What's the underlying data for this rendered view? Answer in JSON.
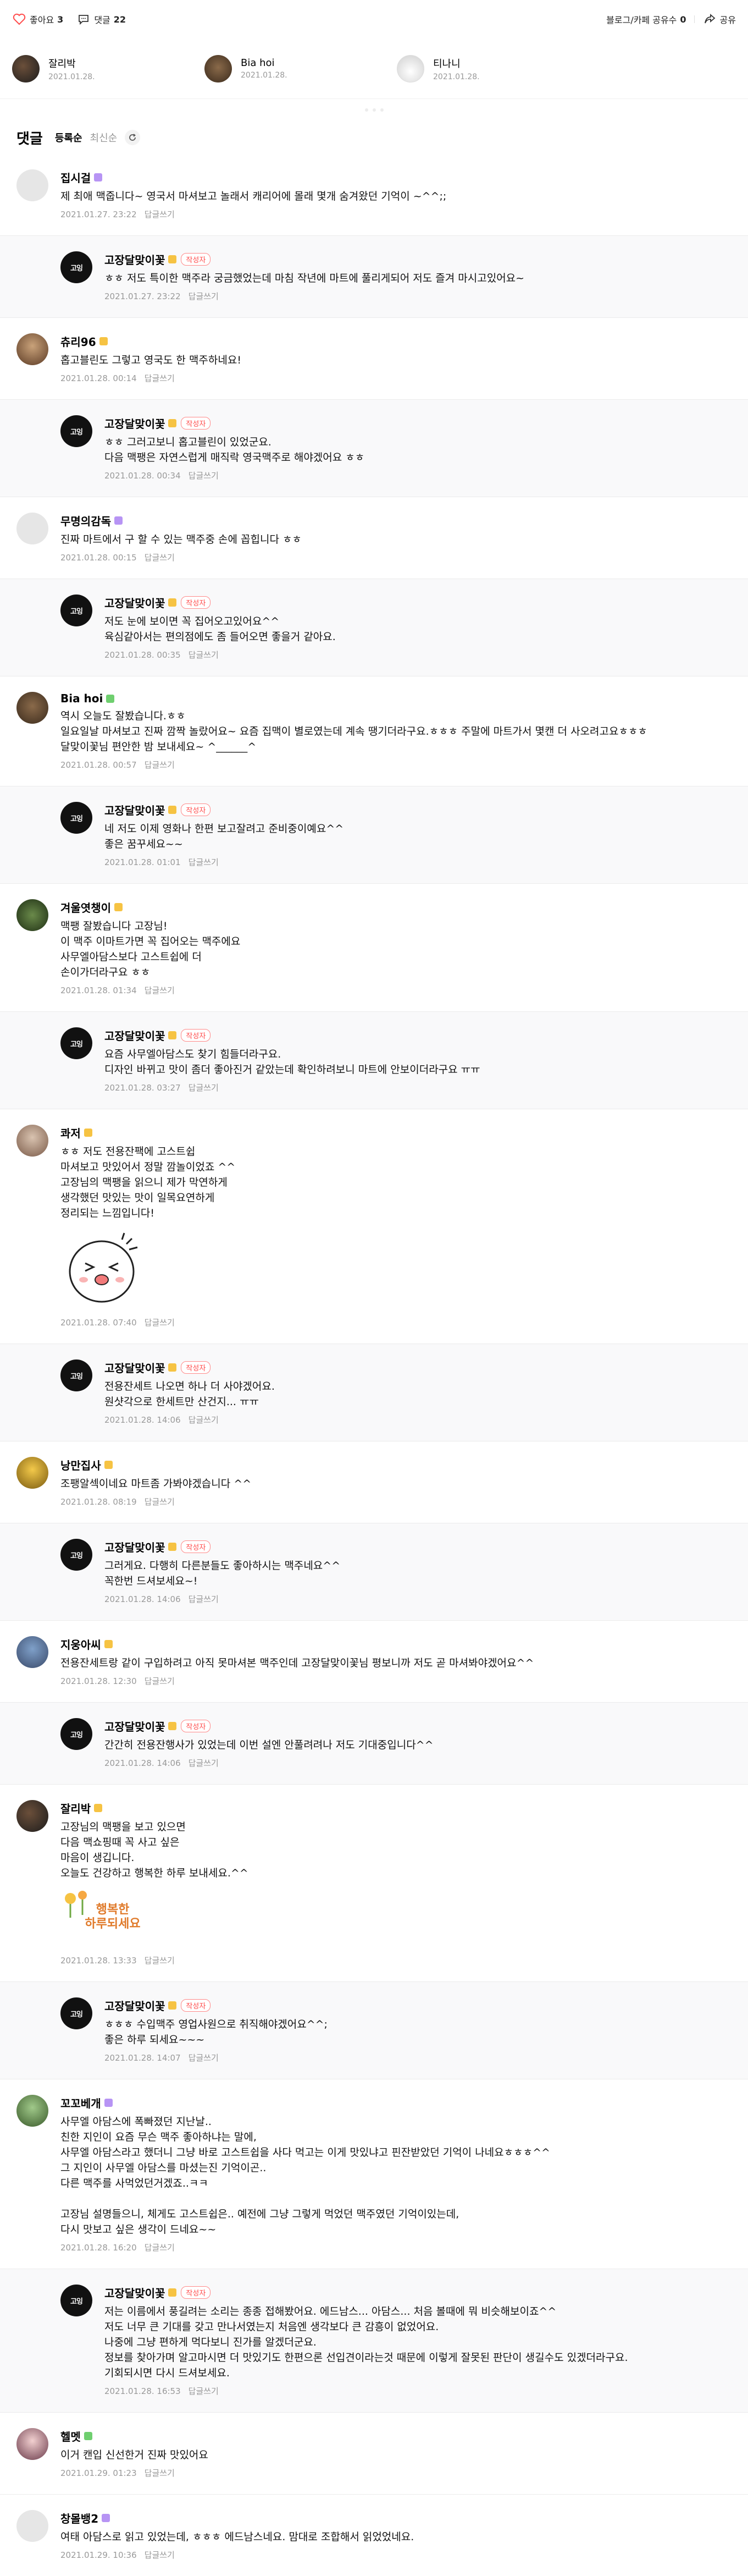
{
  "topbar": {
    "like_label": "좋아요",
    "like_count": "3",
    "comment_label": "댓글",
    "comment_count": "22",
    "share_count_label": "블로그/카페 공유수",
    "share_count": "0",
    "share_label": "공유"
  },
  "likers": [
    {
      "name": "잘리박",
      "date": "2021.01.28."
    },
    {
      "name": "Bia hoi",
      "date": "2021.01.28."
    },
    {
      "name": "티나니",
      "date": "2021.01.28."
    }
  ],
  "comments_header": {
    "title": "댓글",
    "sort_active": "등록순",
    "sort_other": "최신순"
  },
  "writer_badge": "작성자",
  "reply_label": "답글쓰기",
  "avatar_logo_text": "고잉",
  "sticker_text": "행복한\n하루되세요",
  "comments": [
    {
      "name": "집시걸",
      "text": "제 최애 맥줍니다~ 영국서 마셔보고 놀래서 캐리어에 몰래 몇개 숨겨왔던 기억이 ~^^;;",
      "date": "2021.01.27. 23:22"
    },
    {
      "name": "고장달맞이꽃",
      "text": "ㅎㅎ 저도 특이한 맥주라 궁금했었는데 마침 작년에 마트에 풀리게되어 저도 즐겨 마시고있어요~",
      "date": "2021.01.27. 23:22"
    },
    {
      "name": "츄리96",
      "text": "홉고블린도 그렇고 영국도 한 맥주하네요!",
      "date": "2021.01.28. 00:14"
    },
    {
      "name": "고장달맞이꽃",
      "text": "ㅎㅎ 그러고보니 홉고블린이 있었군요.\n다음 맥팽은 자연스럽게 매직락 영국맥주로 해야겠어요 ㅎㅎ",
      "date": "2021.01.28. 00:34"
    },
    {
      "name": "무명의감독",
      "text": "진짜 마트에서 구 할 수 있는 맥주중 손에 꼽힙니다 ㅎㅎ",
      "date": "2021.01.28. 00:15"
    },
    {
      "name": "고장달맞이꽃",
      "text": "저도 눈에 보이면 꼭 집어오고있어요^^\n육심같아서는 편의점에도 좀 들어오면 좋을거 같아요.",
      "date": "2021.01.28. 00:35"
    },
    {
      "name": "Bia hoi",
      "text": "역시 오늘도 잘봤습니다.ㅎㅎ\n일요일날 마셔보고 진짜 깜짝 놀랐어요~ 요즘 집맥이 별로였는데 계속 땡기더라구요.ㅎㅎㅎ 주말에 마트가서 몇캔 더 사오려고요ㅎㅎㅎ\n달맞이꽃님 편안한 밤 보내세요~ ^______^",
      "date": "2021.01.28. 00:57"
    },
    {
      "name": "고장달맞이꽃",
      "text": "네 저도 이제 영화나 한편 보고잘려고 준비중이예요^^\n좋은 꿈꾸세요~~",
      "date": "2021.01.28. 01:01"
    },
    {
      "name": "겨울엿챙이",
      "text": "맥팽 잘봤습니다 고장님!\n이 맥주 이마트가면 꼭 집어오는 맥주에요\n사무엘아담스보다 고스트쉽에 더\n손이가더라구요 ㅎㅎ",
      "date": "2021.01.28. 01:34"
    },
    {
      "name": "고장달맞이꽃",
      "text": "요즘 사무엘아담스도 찾기 힘들더라구요.\n디자인 바뀌고 맛이 좀더 좋아진거 같았는데 확인하려보니 마트에 안보이더라구요 ㅠㅠ",
      "date": "2021.01.28. 03:27"
    },
    {
      "name": "콰저",
      "text": "ㅎㅎ 저도 전용잔팩에 고스트쉽\n마셔보고 맛있어서 정말 깜놀이었죠 ^^\n고장님의 맥팽을 읽으니 제가 막연하게\n생각했던 맛있는 맛이 일목요연하게\n정리되는 느낌입니다!",
      "date": "2021.01.28. 07:40"
    },
    {
      "name": "고장달맞이꽃",
      "text": "전용잔세트 나오면 하나 더 사야겠어요.\n원샷각으로 한세트만 산건지... ㅠㅠ",
      "date": "2021.01.28. 14:06"
    },
    {
      "name": "낭만집사",
      "text": "조팽알섹이네요 마트좀 가봐야겠습니다 ^^",
      "date": "2021.01.28. 08:19"
    },
    {
      "name": "고장달맞이꽃",
      "text": "그러게요. 다행히 다른분들도 좋아하시는 맥주네요^^\n꼭한번 드셔보세요~!",
      "date": "2021.01.28. 14:06"
    },
    {
      "name": "지웅아씨",
      "text": "전용잔세트랑 같이 구입하려고 아직 못마셔본 맥주인데 고장달맞이꽃님 평보니까 저도 곧 마셔봐야겠어요^^",
      "date": "2021.01.28. 12:30"
    },
    {
      "name": "고장달맞이꽃",
      "text": "간간히 전용잔행사가 있었는데 이번 설엔 안풀려려나 저도 기대중입니다^^",
      "date": "2021.01.28. 14:06"
    },
    {
      "name": "잘리박",
      "text": "고장님의 맥팽을 보고 있으면\n다음 맥쇼핑때 꼭 사고 싶은\n마음이 생깁니다.\n오늘도 건강하고 행복한 하루 보내세요.^^",
      "date": "2021.01.28. 13:33"
    },
    {
      "name": "고장달맞이꽃",
      "text": "ㅎㅎㅎ 수입맥주 영업사원으로 취직해야겠어요^^;\n좋은 하루 되세요~~~",
      "date": "2021.01.28. 14:07"
    },
    {
      "name": "꼬꼬베개",
      "text": "사무엘 아담스에 폭빠졌던 지난날..\n친한 지인이 요즘 무슨 맥주 좋아하냐는 말에,\n사무엘 아담스라고 했더니 그냥 바로 고스트쉽을 사다 먹고는 이게 맛있냐고 핀잔받았던 기억이 나네요ㅎㅎㅎ^^\n그 지인이 사무엘 아담스를 마셨는진 기억이곤..\n다른 맥주를 사먹었던거겠죠..ㅋㅋ\n\n고장님 설명들으니, 체게도 고스트쉽은.. 예전에 그냥 그렇게 먹었던 맥주였던 기억이있는데,\n다시 맛보고 싶은 생각이 드네요~~",
      "date": "2021.01.28. 16:20"
    },
    {
      "name": "고장달맞이꽃",
      "text": "저는 이름에서 풍길려는 소리는 종종 접해봤어요. 에드남스... 아담스... 처음 볼때에 뭐 비슷해보이죠^^\n저도 너무 큰 기대를 갖고 만나서였는지 처음엔 생각보다 큰 감흥이 없었어요.\n나중에 그냥 편하게 먹다보니 진가를 알겠더군요.\n정보를 찾아가며 알고마시면 더 맛있기도 한편으론 선입견이라는것 때문에 이렇게 잘못된 판단이 생길수도 있겠더라구요.\n기회되시면 다시 드셔보세요.",
      "date": "2021.01.28. 16:53"
    },
    {
      "name": "헬멧",
      "text": "이거 캔입 신선한거 진짜 맛있어요",
      "date": "2021.01.29. 01:23"
    },
    {
      "name": "창몰뱅2",
      "text": "여태 아담스로 읽고 있었는데, ㅎㅎㅎ 에드남스네요. 맘대로 조합해서 읽었었네요.",
      "date": "2021.01.29. 10:36"
    }
  ],
  "colors": {
    "writer_badge": "#ff4d4d",
    "reply_bg": "#f9f9fa",
    "meta": "#999999",
    "level_badge": "#b794f4",
    "level_badge_alt": "#f6c343",
    "level_badge_green": "#6fcf6f"
  }
}
